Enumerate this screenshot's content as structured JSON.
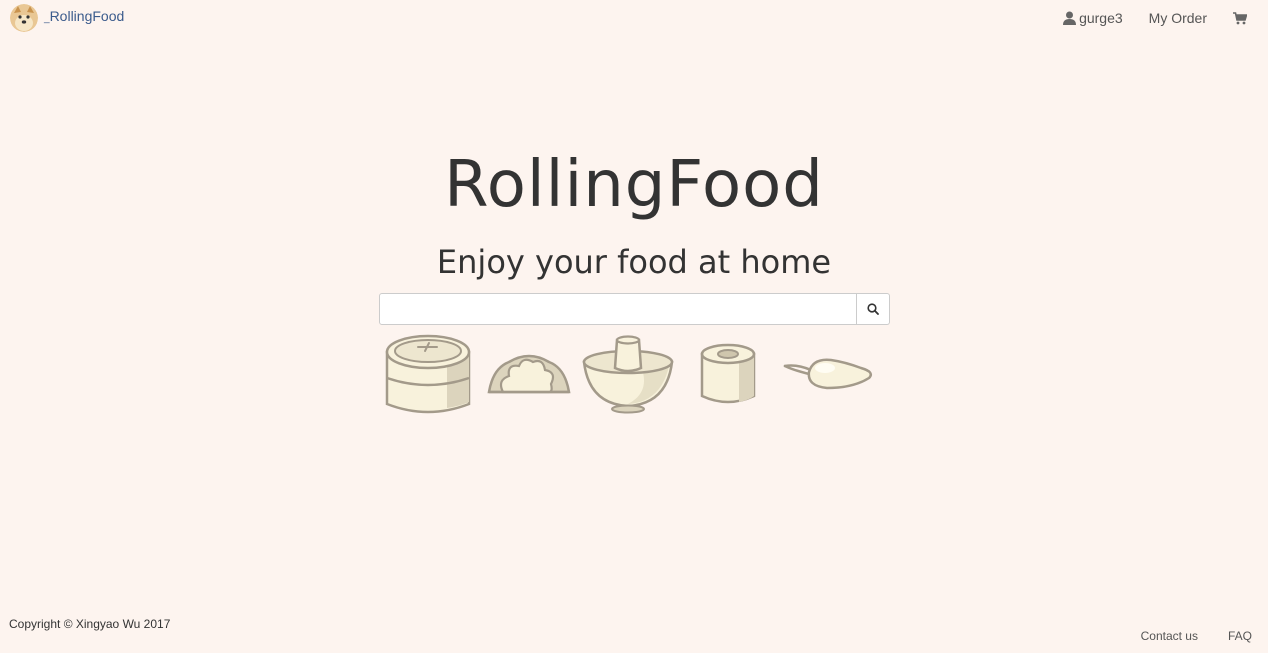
{
  "navbar": {
    "brand_name": "RollingFood",
    "user_name": "gurge3",
    "my_order_label": "My Order"
  },
  "hero": {
    "title": "RollingFood",
    "subtitle": "Enjoy your food at home"
  },
  "search": {
    "value": "",
    "placeholder": ""
  },
  "footer": {
    "copyright": "Copyright © Xingyao Wu 2017",
    "contact_label": "Contact us",
    "faq_label": "FAQ"
  },
  "colors": {
    "background": "#fdf4ef",
    "brand_link": "#3b5b8c",
    "food_fill": "#f8f2dc",
    "food_outline": "#a39a8a"
  },
  "icons": {
    "logo": "doge-avatar-icon",
    "user": "user-icon",
    "cart": "shopping-cart-icon",
    "search": "search-icon",
    "foods": [
      "steamer-basket-icon",
      "dumpling-icon",
      "mortar-bowl-icon",
      "sushi-roll-icon",
      "spoon-icon"
    ]
  }
}
